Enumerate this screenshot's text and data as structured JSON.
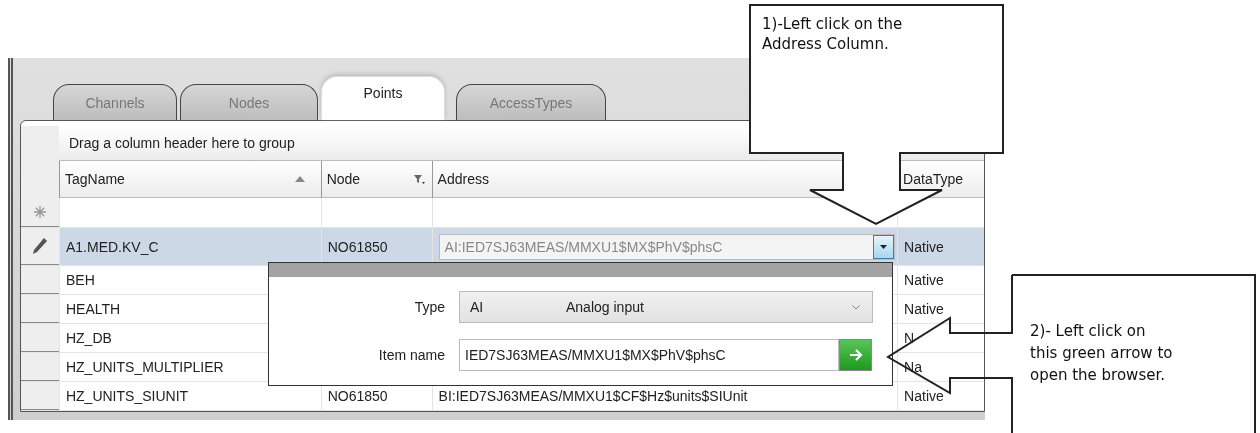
{
  "tabs": [
    {
      "label": "Channels",
      "selected": false
    },
    {
      "label": "Nodes",
      "selected": false
    },
    {
      "label": "Points",
      "selected": true
    },
    {
      "label": "AccessTypes",
      "selected": false
    }
  ],
  "grid": {
    "group_hint": "Drag a column header here to group",
    "columns": [
      {
        "label": "TagName",
        "sorted": true,
        "filter": false
      },
      {
        "label": "Node",
        "sorted": false,
        "filter": true
      },
      {
        "label": "Address",
        "sorted": false,
        "filter": false
      },
      {
        "label": "DataType",
        "sorted": false,
        "filter": false
      }
    ],
    "rows": [
      {
        "kind": "new",
        "selected": false
      },
      {
        "kind": "edit",
        "selected": true,
        "tag": "A1.MED.KV_C",
        "node": "NO61850",
        "address": "AI:IED7SJ63MEAS/MMXU1$MX$PhV$phsC",
        "data_type": "Native"
      },
      {
        "kind": "plain",
        "selected": false,
        "tag": "BEH",
        "data_type": "Native"
      },
      {
        "kind": "plain",
        "selected": false,
        "tag": "HEALTH",
        "data_type": "Native"
      },
      {
        "kind": "plain",
        "selected": false,
        "tag": "HZ_DB",
        "data_type": "N"
      },
      {
        "kind": "plain",
        "selected": false,
        "tag": "HZ_UNITS_MULTIPLIER",
        "data_type": "Na"
      },
      {
        "kind": "plain",
        "selected": false,
        "tag": "HZ_UNITS_SIUNIT",
        "node": "NO61850",
        "address": "BI:IED7SJ63MEAS/MMXU1$CF$Hz$units$SIUnit",
        "data_type": "Native"
      }
    ]
  },
  "popup": {
    "type_label": "Type",
    "type_code": "AI",
    "type_name": "Analog input",
    "item_label": "Item name",
    "item_value": "IED7SJ63MEAS/MMXU1$MX$PhV$phsC"
  },
  "callouts": [
    {
      "text": "1)-Left click on the\nAddress Column."
    },
    {
      "text": "2)- Left click on\nthis green arrow to\nopen the browser."
    }
  ]
}
